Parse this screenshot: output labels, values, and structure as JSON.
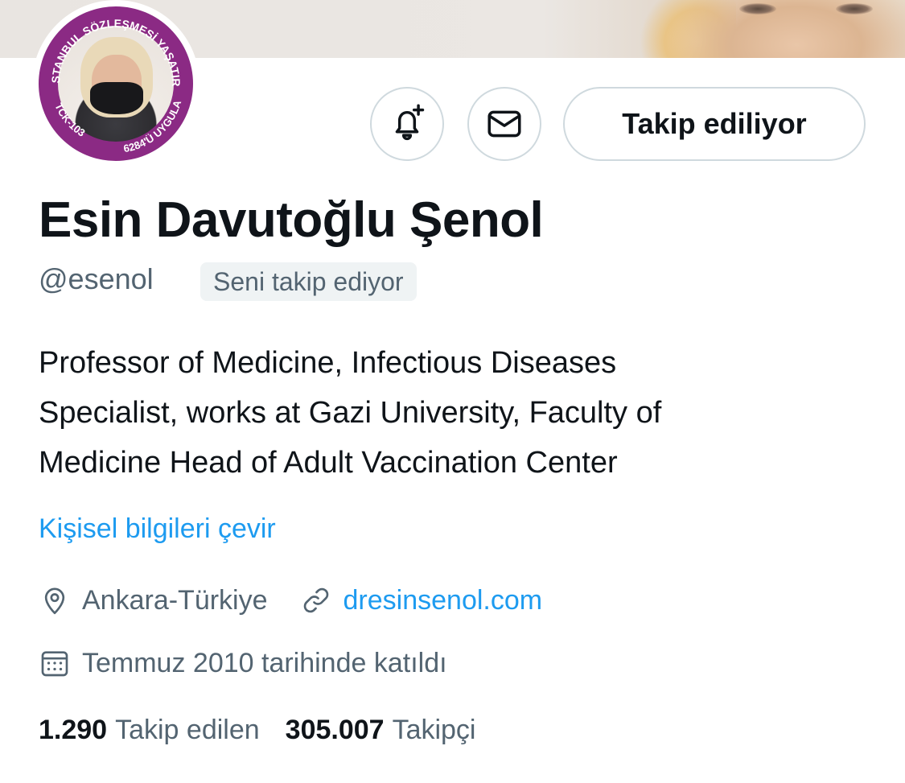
{
  "colors": {
    "accent": "#1d9bf0",
    "text_primary": "#0f1419",
    "text_secondary": "#536471",
    "border": "#cfd9de",
    "avatar_frame": "#8b2a84"
  },
  "avatar": {
    "badge_top_text": "İSTANBUL SÖZLEŞMESİ YAŞATIR",
    "badge_left_text": "TCK-103",
    "badge_bottom_text": "6284'Ü UYGULA"
  },
  "actions": {
    "notify_icon": "bell-plus-icon",
    "message_icon": "envelope-icon",
    "follow_label": "Takip ediliyor"
  },
  "profile": {
    "name": "Esin Davutoğlu Şenol",
    "handle": "@esenol",
    "follows_you": "Seni takip ediyor",
    "bio_lines": [
      "Professor of Medicine, Infectious Diseases",
      "Specialist, works at Gazi University, Faculty of",
      "Medicine Head of Adult Vaccination Center"
    ],
    "translate_label": "Kişisel bilgileri çevir",
    "location": "Ankara-Türkiye",
    "website": "dresinsenol.com",
    "joined": "Temmuz 2010 tarihinde katıldı"
  },
  "stats": {
    "following_count": "1.290",
    "following_label": "Takip edilen",
    "followers_count": "305.007",
    "followers_label": "Takipçi"
  }
}
